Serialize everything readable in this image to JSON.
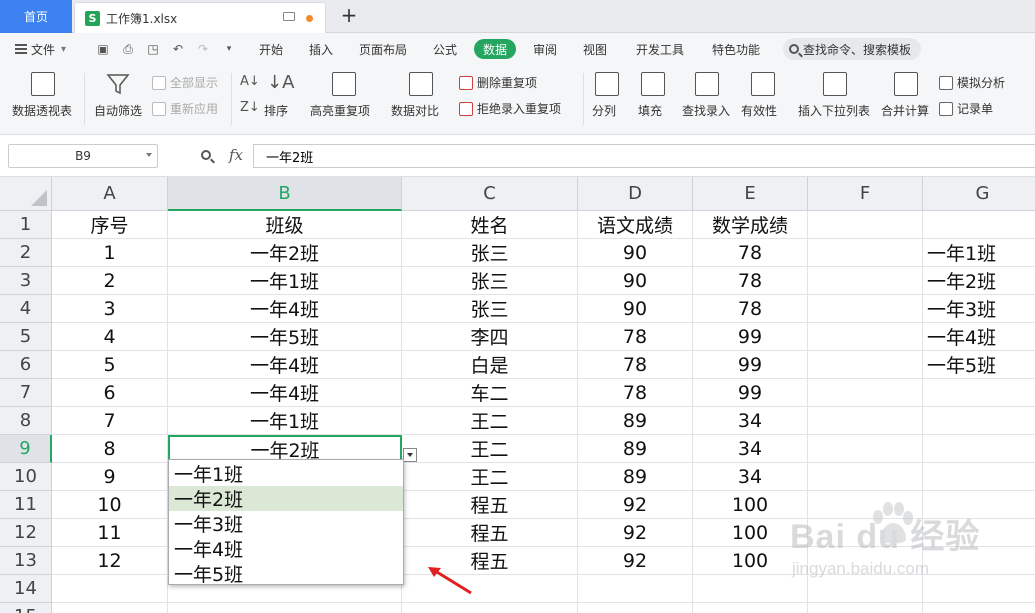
{
  "tabs": {
    "home": "首页",
    "document": "工作簿1.xlsx",
    "new_tab": "+"
  },
  "menu": {
    "file": "文件",
    "items": [
      "开始",
      "插入",
      "页面布局",
      "公式",
      "数据",
      "审阅",
      "视图",
      "开发工具",
      "特色功能"
    ],
    "active": "数据",
    "search": "查找命令、搜索模板"
  },
  "ribbon": {
    "pivot": "数据透视表",
    "autofilter": "自动筛选",
    "show_all": "全部显示",
    "reapply": "重新应用",
    "sort": "排序",
    "highlight_dup": "高亮重复项",
    "compare": "数据对比",
    "remove_dup": "删除重复项",
    "reject_dup": "拒绝录入重复项",
    "split": "分列",
    "fill": "填充",
    "lookup_entry": "查找录入",
    "validity": "有效性",
    "insert_dropdown": "插入下拉列表",
    "consolidate": "合并计算",
    "what_if": "模拟分析",
    "record_sheet": "记录单"
  },
  "formula_bar": {
    "name_box": "B9",
    "fx": "fx",
    "formula": "一年2班"
  },
  "columns": [
    "A",
    "B",
    "C",
    "D",
    "E",
    "F",
    "G"
  ],
  "rows": [
    "1",
    "2",
    "3",
    "4",
    "5",
    "6",
    "7",
    "8",
    "9",
    "10",
    "11",
    "12",
    "13",
    "14",
    "15"
  ],
  "headers": [
    "序号",
    "班级",
    "姓名",
    "语文成绩",
    "数学成绩"
  ],
  "records": [
    [
      "1",
      "一年2班",
      "张三",
      "90",
      "78"
    ],
    [
      "2",
      "一年1班",
      "张三",
      "90",
      "78"
    ],
    [
      "3",
      "一年4班",
      "张三",
      "90",
      "78"
    ],
    [
      "4",
      "一年5班",
      "李四",
      "78",
      "99"
    ],
    [
      "5",
      "一年4班",
      "白是",
      "78",
      "99"
    ],
    [
      "6",
      "一年4班",
      "车二",
      "78",
      "99"
    ],
    [
      "7",
      "一年1班",
      "王二",
      "89",
      "34"
    ],
    [
      "8",
      "一年2班",
      "王二",
      "89",
      "34"
    ],
    [
      "9",
      "",
      "王二",
      "89",
      "34"
    ],
    [
      "10",
      "",
      "程五",
      "92",
      "100"
    ],
    [
      "11",
      "",
      "程五",
      "92",
      "100"
    ],
    [
      "12",
      "",
      "程五",
      "92",
      "100"
    ]
  ],
  "source_list": [
    "一年1班",
    "一年2班",
    "一年3班",
    "一年4班",
    "一年5班"
  ],
  "dropdown": {
    "options": [
      "一年1班",
      "一年2班",
      "一年3班",
      "一年4班",
      "一年5班"
    ],
    "highlighted_index": 1
  },
  "watermark": {
    "main": "Bai du 经验",
    "sub": "jingyan.baidu.com"
  },
  "colors": {
    "accent_green": "#25a660",
    "home_blue": "#3c82f0",
    "arrow_red": "#e02020"
  }
}
